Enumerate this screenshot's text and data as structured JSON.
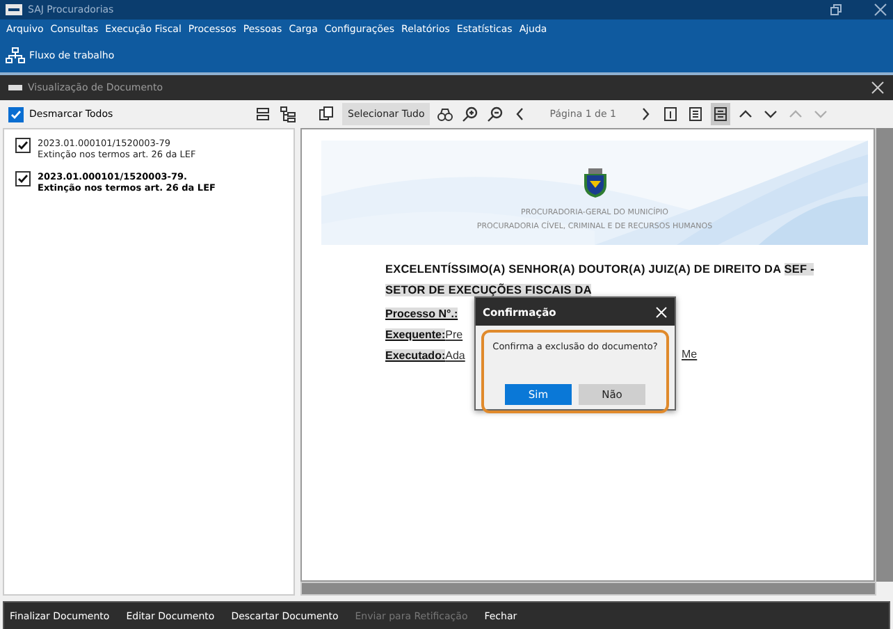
{
  "window": {
    "title": "SAJ Procuradorias"
  },
  "menu": [
    "Arquivo",
    "Consultas",
    "Execução Fiscal",
    "Processos",
    "Pessoas",
    "Carga",
    "Configurações",
    "Relatórios",
    "Estatísticas",
    "Ajuda"
  ],
  "toolbar": {
    "label": "Fluxo de trabalho"
  },
  "document_window": {
    "title": "Visualização de Documento",
    "uncheck_all": {
      "label": "Desmarcar Todos",
      "checked": true
    },
    "select_all": "Selecionar Tudo",
    "page": "Página 1 de 1",
    "view_modes": [
      {
        "selected": false
      },
      {
        "selected": false
      },
      {
        "selected": true
      }
    ],
    "documents": [
      {
        "number": "2023.01.000101/1520003-79",
        "description": "Extinção nos termos art. 26 da LEF",
        "checked": true,
        "selected": false
      },
      {
        "number": "2023.01.000101/1520003-79.",
        "description": "Extinção nos termos art. 26 da LEF",
        "checked": true,
        "selected": true
      }
    ],
    "page_content": {
      "header": [
        "PROCURADORIA-GERAL DO MUNICÍPIO",
        "PROCURADORIA CÍVEL, CRIMINAL E DE RECURSOS HUMANOS"
      ],
      "address": [
        "EXCELENTÍSSIMO(A) SENHOR(A) DOUTOR(A) JUIZ(A) DE DIREITO DA ",
        "SEF -",
        "SETOR DE EXECUÇÕES FISCAIS DA"
      ],
      "fields": [
        {
          "label": "Processo N°.:"
        },
        {
          "label": "Exequente:",
          "value": "Pre"
        },
        {
          "label": "Executado:",
          "value": "Ada",
          "tail": "Me"
        }
      ]
    },
    "actions": [
      {
        "label": "Finalizar Documento",
        "disabled": false
      },
      {
        "label": "Editar Documento",
        "disabled": false
      },
      {
        "label": "Descartar Documento",
        "disabled": false
      },
      {
        "label": "Enviar para Retificação",
        "disabled": true
      },
      {
        "label": "Fechar",
        "disabled": false
      }
    ]
  },
  "dialog": {
    "title": "Confirmação",
    "message": "Confirma a exclusão do documento?",
    "buttons": [
      {
        "label": "Sim",
        "selected": true
      },
      {
        "label": "Não",
        "selected": false
      }
    ]
  }
}
